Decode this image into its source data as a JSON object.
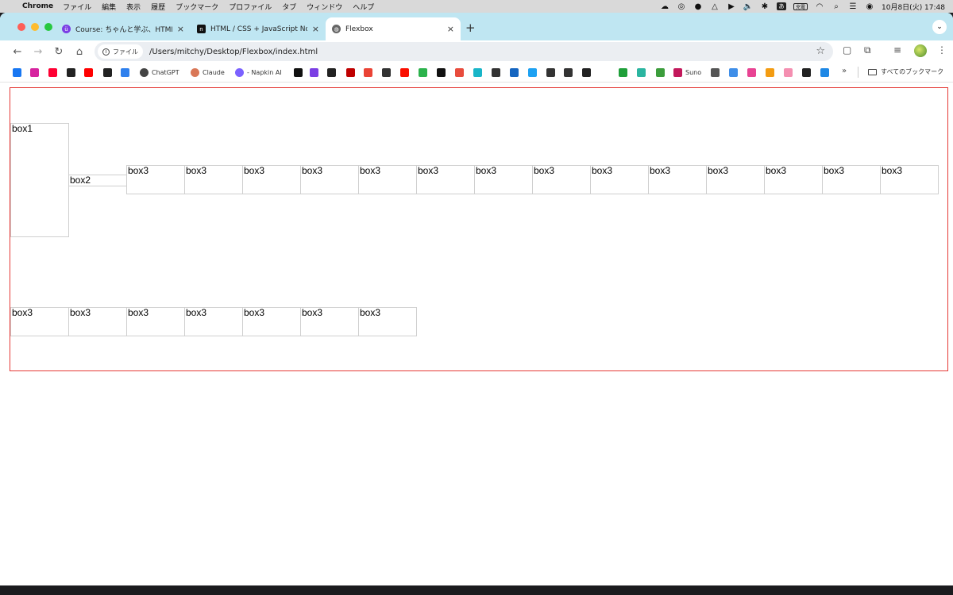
{
  "menubar": {
    "app": "Chrome",
    "menus": [
      "ファイル",
      "編集",
      "表示",
      "履歴",
      "ブックマーク",
      "プロファイル",
      "タブ",
      "ウィンドウ",
      "ヘルプ"
    ],
    "input_mode": "あ",
    "battery": "充電",
    "datetime": "10月8日(火)  17:48"
  },
  "tabs": [
    {
      "title": "Course: ちゃんと学ぶ、HTML/(",
      "favicon": "course-icon",
      "color": "#7b3fe4"
    },
    {
      "title": "HTML / CSS + JavaScript No",
      "favicon": "notion-icon",
      "color": "#111111"
    },
    {
      "title": "Flexbox",
      "favicon": "globe-icon",
      "color": "#555555",
      "active": true
    }
  ],
  "omnibox": {
    "chip": "ファイル",
    "url": "/Users/mitchy/Desktop/Flexbox/index.html"
  },
  "bookmarks": {
    "items": [
      {
        "label": "",
        "icon": "facebook-icon",
        "color": "#1877f2"
      },
      {
        "label": "",
        "icon": "instagram-icon",
        "color": "#d6249f"
      },
      {
        "label": "",
        "icon": "yahoo-icon",
        "color": "#ff0033"
      },
      {
        "label": "",
        "icon": "slash-icon",
        "color": "#222222"
      },
      {
        "label": "",
        "icon": "youtube-icon",
        "color": "#ff0000"
      },
      {
        "label": "",
        "icon": "apple-icon",
        "color": "#222222"
      },
      {
        "label": "",
        "icon": "apple-blue-icon",
        "color": "#2f80ed"
      },
      {
        "label": "ChatGPT",
        "icon": "chatgpt-icon",
        "color": "#444444"
      },
      {
        "label": "Claude",
        "icon": "claude-icon",
        "color": "#d97757"
      },
      {
        "label": "- Napkin AI",
        "icon": "napkin-icon",
        "color": "#7b61ff"
      },
      {
        "label": "",
        "icon": "note-icon",
        "color": "#111111"
      },
      {
        "label": "",
        "icon": "course-icon",
        "color": "#7b3fe4"
      },
      {
        "label": "",
        "icon": "amazon-icon",
        "color": "#222222"
      },
      {
        "label": "",
        "icon": "rakuten-icon",
        "color": "#bf0000"
      },
      {
        "label": "",
        "icon": "gmail-icon",
        "color": "#ea4335"
      },
      {
        "label": "",
        "icon": "app-icon",
        "color": "#333333"
      },
      {
        "label": "",
        "icon": "adobe-icon",
        "color": "#fa0f00"
      },
      {
        "label": "",
        "icon": "feedly-icon",
        "color": "#2bb24c"
      },
      {
        "label": "",
        "icon": "app-icon",
        "color": "#111111"
      },
      {
        "label": "",
        "icon": "app-icon",
        "color": "#e84c3d"
      },
      {
        "label": "",
        "icon": "app-icon",
        "color": "#19b5c8"
      },
      {
        "label": "",
        "icon": "app-icon",
        "color": "#333333"
      },
      {
        "label": "",
        "icon": "app-icon",
        "color": "#1565c0"
      },
      {
        "label": "",
        "icon": "twitter-icon",
        "color": "#1da1f2"
      },
      {
        "label": "",
        "icon": "app-icon",
        "color": "#333333"
      },
      {
        "label": "",
        "icon": "camera-icon",
        "color": "#333333"
      },
      {
        "label": "",
        "icon": "app-icon",
        "color": "#222222"
      },
      {
        "label": "",
        "icon": "app-icon",
        "color": "#1f9f3a"
      },
      {
        "label": "",
        "icon": "app-icon",
        "color": "#2bb5a0"
      },
      {
        "label": "",
        "icon": "app-icon",
        "color": "#3c9d3c"
      },
      {
        "label": "Suno",
        "icon": "suno-icon",
        "color": "#c2185b"
      },
      {
        "label": "",
        "icon": "app-icon",
        "color": "#555555"
      },
      {
        "label": "",
        "icon": "app-icon",
        "color": "#3f8ee8"
      },
      {
        "label": "",
        "icon": "app-icon",
        "color": "#e84393"
      },
      {
        "label": "",
        "icon": "app-icon",
        "color": "#f39c12"
      },
      {
        "label": "",
        "icon": "heart-icon",
        "color": "#f48fb1"
      },
      {
        "label": "",
        "icon": "globe-icon",
        "color": "#222222"
      },
      {
        "label": "",
        "icon": "app-icon",
        "color": "#1e88e5"
      }
    ],
    "more": "»",
    "folder": "すべてのブックマーク"
  },
  "page": {
    "box1": "box1",
    "box2": "box2",
    "row1": [
      "box3",
      "box3",
      "box3",
      "box3",
      "box3",
      "box3",
      "box3",
      "box3",
      "box3",
      "box3",
      "box3",
      "box3",
      "box3",
      "box3"
    ],
    "row2": [
      "box3",
      "box3",
      "box3",
      "box3",
      "box3",
      "box3",
      "box3"
    ]
  },
  "colors": {
    "container_border": "#e53935",
    "box_border": "#cfcfcf",
    "tabstrip": "#bfe6f2"
  }
}
